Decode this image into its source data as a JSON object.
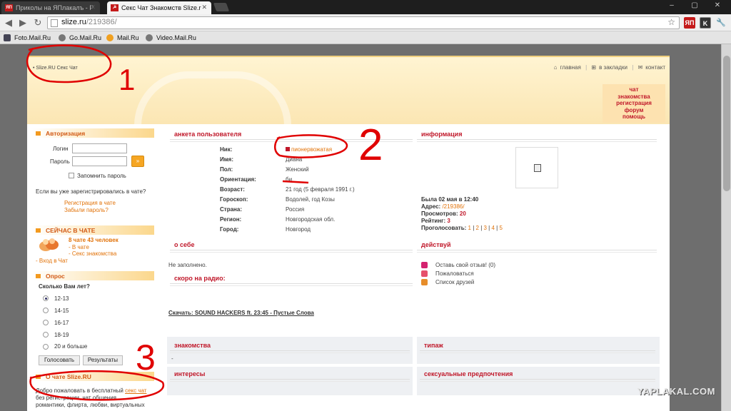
{
  "browser": {
    "tabs": [
      {
        "fav": "ЯП",
        "title": "Приколы на ЯПлакалъ - Р"
      },
      {
        "fav": "☭",
        "title": "Секс Чат Знакомств Slize.r"
      }
    ],
    "url_host": "slize.ru",
    "url_path": "/219386/",
    "bookmarks": [
      "Foto.Mail.Ru",
      "Go.Mail.Ru",
      "Mail.Ru",
      "Video.Mail.Ru"
    ],
    "extensions": [
      "ЯП",
      "K"
    ]
  },
  "site": {
    "breadcrumb": "• Slize.RU  Секс Чат",
    "toplinks": [
      "главная",
      "в закладки",
      "контакт"
    ],
    "promo": [
      "чат",
      "знакомства",
      "регистрация",
      "форум",
      "помощь"
    ]
  },
  "sidebar": {
    "auth": {
      "title": "Авторизация",
      "login_label": "Логин",
      "password_label": "Пароль",
      "go": "»",
      "remember": "Запомнить пароль",
      "registered_q": "Если вы уже зарегистрировались в чате?",
      "links": [
        "Регистрация в чате",
        "Забыли пароль?"
      ]
    },
    "now": {
      "title": "СЕЙЧАС В ЧАТЕ",
      "count": "8 чате 43 человек",
      "links": [
        "- В чате",
        "- Секс знакомства"
      ],
      "enter": "- Вход в Чат"
    },
    "poll": {
      "title": "Опрос",
      "question": "Сколько Вам лет?",
      "options": [
        "12-13",
        "14-15",
        "16-17",
        "18-19",
        "20 и больше"
      ],
      "vote": "Голосовать",
      "results": "Результаты"
    },
    "about": {
      "title": "О чате Slize.RU",
      "text1": "Добро пожаловать в бесплатный ",
      "text_link": "секс чат",
      "text2": "без регистрации, чат общения",
      "text3": "романтики, флирта, любви, виртуальных"
    }
  },
  "profile": {
    "title": "анкета пользователя",
    "labels": [
      "Ник:",
      "Имя:",
      "Пол:",
      "Ориентация:",
      "Возраст:",
      "Гороскоп:",
      "Страна:",
      "Регион:",
      "Город:"
    ],
    "values": [
      "пионервожатая",
      "Диана",
      "Женский",
      "би",
      "21 год (5 февраля 1991 г.)",
      "Водолей, год Козы",
      "Россия",
      "Новгородская обл.",
      "Новгород"
    ]
  },
  "info": {
    "title": "информация",
    "last_seen_label": "Была",
    "last_seen_value": "02 мая в 12:40",
    "address_label": "Адрес:",
    "address_value": "/219386/",
    "views_label": "Просмотров:",
    "views_value": "20",
    "rating_label": "Рейтинг:",
    "rating_value": "3",
    "vote_label": "Проголосовать:",
    "vote_options": [
      "1",
      "2",
      "3",
      "4",
      "5"
    ]
  },
  "about_me": {
    "title": "о себе",
    "text": "Не заполнено."
  },
  "actions": {
    "title": "действуй",
    "items": [
      "Оставь свой отзыв! (0)",
      "Пожаловаться",
      "Список друзей"
    ]
  },
  "radio": {
    "title": "скоро на радио:",
    "track": "Скачать: SOUND HACKERS ft. 23:45 - Пустые Слова"
  },
  "sections": {
    "dating": "знакомства",
    "dating_value": "-",
    "type": "типаж",
    "interests": "интересы",
    "prefs": "сексуальные предпочтения"
  },
  "annotations": [
    "1",
    "2",
    "3"
  ],
  "watermark": "YAPLAKAL.COM",
  "colors": {
    "accent_red": "#c0182a",
    "accent_orange": "#e2730a",
    "annotation": "#e00000"
  }
}
